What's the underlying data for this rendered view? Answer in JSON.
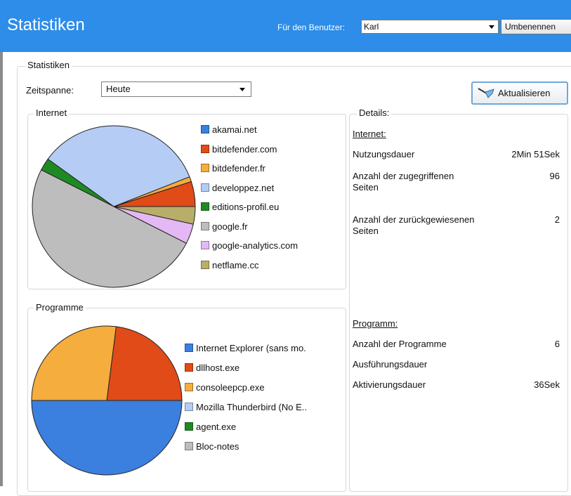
{
  "header": {
    "title": "Statistiken",
    "user_label": "Für den Benutzer:",
    "user_value": "Karl",
    "rename_label": "Umbenennen",
    "bg_color": "#2d8de8"
  },
  "main": {
    "group_title": "Statistiken",
    "period_label": "Zeitspanne:",
    "period_value": "Heute",
    "refresh_label": "Aktualisieren",
    "refresh_icon": "broom-icon"
  },
  "internet": {
    "group_title": "Internet",
    "chart_data": {
      "type": "pie",
      "slices": [
        {
          "label": "akamai.net",
          "value": 0,
          "color": "#3b7fdf"
        },
        {
          "label": "bitdefender.com",
          "value": 5,
          "color": "#e04b18"
        },
        {
          "label": "bitdefender.fr",
          "value": 1,
          "color": "#f5ad3e"
        },
        {
          "label": "developpez.net",
          "value": 34,
          "color": "#b5ccf5"
        },
        {
          "label": "editions-profil.eu",
          "value": 2.5,
          "color": "#1e8a23"
        },
        {
          "label": "google.fr",
          "value": 50,
          "color": "#bdbdbd"
        },
        {
          "label": "google-analytics.com",
          "value": 4,
          "color": "#e3b8f4"
        },
        {
          "label": "netflame.cc",
          "value": 3.5,
          "color": "#b8ae6a"
        }
      ]
    }
  },
  "programs": {
    "group_title": "Programme",
    "chart_data": {
      "type": "pie",
      "slices": [
        {
          "label": "Internet Explorer (sans mo.",
          "value": 50,
          "color": "#3b7fdf"
        },
        {
          "label": "dllhost.exe",
          "value": 23,
          "color": "#e04b18"
        },
        {
          "label": "consoleepcp.exe",
          "value": 27,
          "color": "#f5ad3e"
        },
        {
          "label": "Mozilla Thunderbird (No E..",
          "value": 0,
          "color": "#b5ccf5"
        },
        {
          "label": "agent.exe",
          "value": 0,
          "color": "#1e8a23"
        },
        {
          "label": "Bloc-notes",
          "value": 0,
          "color": "#bdbdbd"
        }
      ]
    }
  },
  "details": {
    "group_title": "Details:",
    "internet_heading": "Internet:",
    "usage_label": "Nutzungsdauer",
    "usage_value": "2Min 51Sek",
    "pages_accessed_label_1": "Anzahl der zugegriffenen",
    "pages_accessed_label_2": "Seiten",
    "pages_accessed_value": "96",
    "pages_rejected_label_1": "Anzahl der zurückgewiesenen",
    "pages_rejected_label_2": "Seiten",
    "pages_rejected_value": "2",
    "program_heading": "Programm:",
    "program_count_label": "Anzahl der Programme",
    "program_count_value": "6",
    "exec_time_label": "Ausführungsdauer",
    "activation_label": "Aktivierungsdauer",
    "activation_value": "36Sek"
  }
}
